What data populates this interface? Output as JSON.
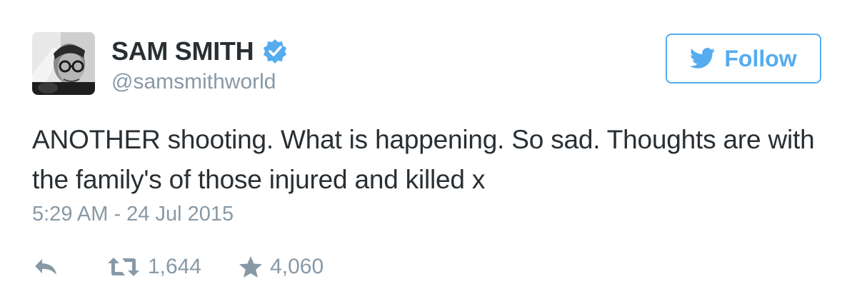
{
  "user": {
    "display_name": "SAM SMITH",
    "handle": "@samsmithworld",
    "verified": true,
    "avatar_icon": "profile-photo"
  },
  "follow_button": {
    "label": "Follow",
    "icon": "twitter-bird-icon"
  },
  "tweet": {
    "text": "ANOTHER shooting. What is happening. So sad. Thoughts are with the family's of those injured and killed x",
    "timestamp": "5:29 AM - 24 Jul 2015"
  },
  "actions": {
    "reply_icon": "reply-icon",
    "retweet_icon": "retweet-icon",
    "retweet_count": "1,644",
    "favorite_icon": "star-icon",
    "favorite_count": "4,060"
  },
  "colors": {
    "accent": "#55acee",
    "text": "#292f33",
    "muted": "#8899a6"
  }
}
